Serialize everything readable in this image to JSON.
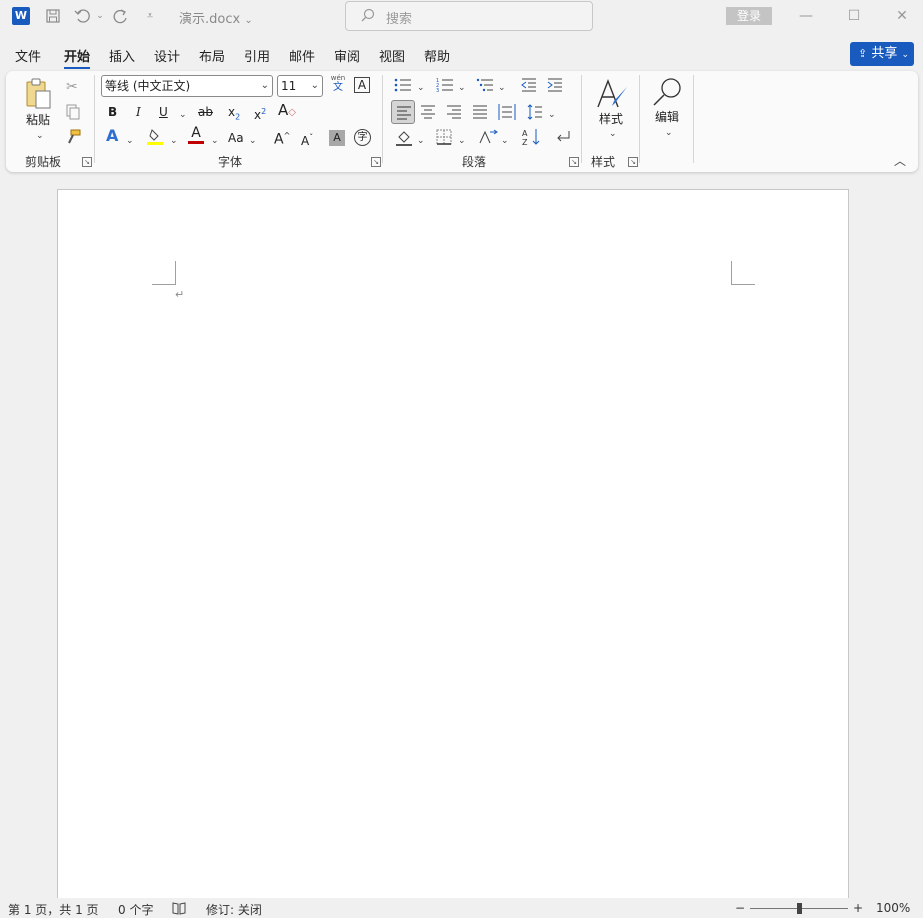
{
  "titlebar": {
    "app_icon": "word-icon",
    "app_letter": "W",
    "doc_title": "演示.docx",
    "search_placeholder": "搜索",
    "login_label": "登录"
  },
  "menu": {
    "items": [
      "文件",
      "开始",
      "插入",
      "设计",
      "布局",
      "引用",
      "邮件",
      "审阅",
      "视图",
      "帮助"
    ],
    "active": "开始",
    "share_label": "共享"
  },
  "ribbon": {
    "clipboard": {
      "paste_label": "粘贴",
      "group_label": "剪贴板"
    },
    "font": {
      "font_name": "等线 (中文正文)",
      "font_size": "11",
      "group_label": "字体",
      "phonetic_top": "wén",
      "phonetic_bottom": "文",
      "border_char": "A",
      "bold": "B",
      "italic": "I",
      "underline": "U",
      "strike": "ab",
      "sub_base": "x",
      "sub_mark": "2",
      "sup_base": "x",
      "sup_mark": "2",
      "clear_char": "A",
      "effects_char": "A",
      "color_char": "A",
      "case_label": "Aa",
      "grow_char": "A",
      "shrink_char": "A",
      "shade_char": "A",
      "enclose_char": "字"
    },
    "paragraph": {
      "group_label": "段落"
    },
    "styles": {
      "styles_label": "样式",
      "group_label": "样式"
    },
    "editing": {
      "label": "编辑"
    }
  },
  "document": {
    "paragraph_mark": "↵"
  },
  "statusbar": {
    "page_info": "第 1 页，共 1 页",
    "word_count": "0 个字",
    "track_changes": "修订: 关闭",
    "zoom_minus": "−",
    "zoom_plus": "+",
    "zoom_level": "100%"
  },
  "colors": {
    "accent": "#185abd",
    "font_color": "#c00000",
    "highlight": "#ffff00"
  }
}
